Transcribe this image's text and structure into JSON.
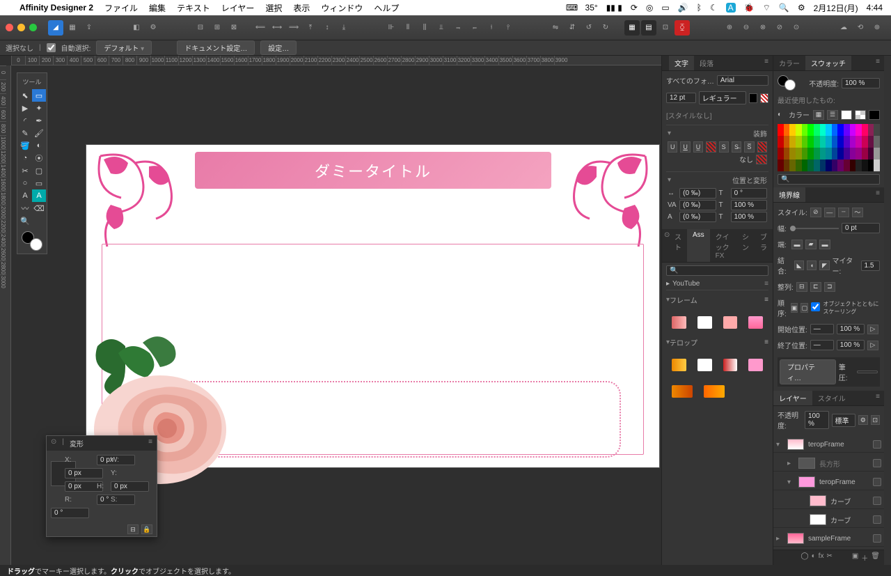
{
  "menubar": {
    "app": "Affinity Designer 2",
    "items": [
      "ファイル",
      "編集",
      "テキスト",
      "レイヤー",
      "選択",
      "表示",
      "ウィンドウ",
      "ヘルプ"
    ],
    "temp": "35°",
    "date": "2月12日(月)",
    "time": "4:44"
  },
  "context": {
    "sel_none": "選択なし",
    "auto_sel": "自動選択:",
    "dropdown": "デフォルト",
    "doc_settings": "ドキュメント設定…",
    "prefs": "設定…"
  },
  "tools_title": "ツール",
  "canvas": {
    "title_text": "ダミータイトル"
  },
  "float": {
    "tab": "変形",
    "x": "X:",
    "y": "Y:",
    "w": "W:",
    "h": "H:",
    "r": "R:",
    "s": "S:",
    "xval": "0 px",
    "yval": "0 px",
    "wval": "0 px",
    "hval": "0 px",
    "rval": "0 °",
    "sval": "0 °"
  },
  "char_panel": {
    "tab1": "文字",
    "tab2": "段落",
    "font_family_label": "すべてのフォ…",
    "font_family": "Arial",
    "font_size": "12 pt",
    "font_weight": "レギュラー",
    "style_none": "[スタイルなし]",
    "deco_h": "装飾",
    "bg_none": "なし",
    "pos_h": "位置と変形",
    "x_pct": "(0 ‰)",
    "y_pct": "(0 ‰)",
    "z_pct": "(0 ‰)",
    "rot": "0 °",
    "scale1": "100 %",
    "scale2": "100 %"
  },
  "assets_panel": {
    "tabs": [
      "スト",
      "Ass",
      "クイックFX",
      "シン",
      "ブラ"
    ],
    "yt": "YouTube",
    "frame_h": "フレーム",
    "telop_h": "テロップ"
  },
  "swatch_panel": {
    "tab1": "カラー",
    "tab2": "スウォッチ",
    "opacity_label": "不透明度:",
    "opacity": "100 %",
    "recent": "最近使用したもの:",
    "color_h": "カラー"
  },
  "stroke_panel": {
    "tab": "境界線",
    "style_label": "スタイル:",
    "width": "0 pt",
    "join_label": "結合:",
    "miter_label": "マイター:",
    "miter": "1.5",
    "align_label": "整列:",
    "order_label": "順序:",
    "scale_chk": "オブジェクトとともにスケーリング",
    "start_label": "開始位置:",
    "start_pct": "100 %",
    "end_label": "終了位置:",
    "end_pct": "100 %",
    "props": "プロパティ…",
    "press_label": "筆圧:"
  },
  "layers_panel": {
    "tab1": "レイヤー",
    "tab2": "スタイル",
    "opacity_label": "不透明度:",
    "opacity": "100 %",
    "blend": "標準",
    "items": [
      {
        "name": "teropFrame",
        "lvl": 0
      },
      {
        "name": "長方形",
        "lvl": 1,
        "dim": true
      },
      {
        "name": "teropFrame",
        "lvl": 1
      },
      {
        "name": "カーブ",
        "lvl": 2
      },
      {
        "name": "カーブ",
        "lvl": 2
      },
      {
        "name": "sampleFrame",
        "lvl": 0
      }
    ]
  },
  "status": {
    "hint_a": "ドラッグ",
    "hint_b": "でマーキー選択します。",
    "hint_c": "クリック",
    "hint_d": "でオブジェクトを選択します。"
  }
}
